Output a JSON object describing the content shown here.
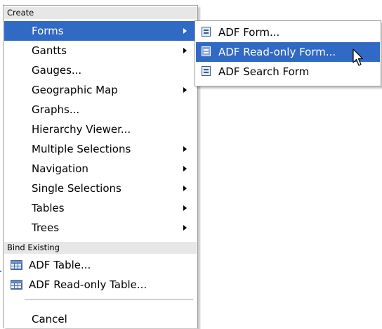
{
  "main_menu": {
    "create_header": "Create",
    "create_items": [
      {
        "label": "Forms",
        "has_submenu": true,
        "highlighted": true
      },
      {
        "label": "Gantts",
        "has_submenu": true
      },
      {
        "label": "Gauges...",
        "has_submenu": false
      },
      {
        "label": "Geographic Map",
        "has_submenu": true
      },
      {
        "label": "Graphs...",
        "has_submenu": false
      },
      {
        "label": "Hierarchy Viewer...",
        "has_submenu": false
      },
      {
        "label": "Multiple Selections",
        "has_submenu": true
      },
      {
        "label": "Navigation",
        "has_submenu": true
      },
      {
        "label": "Single Selections",
        "has_submenu": true
      },
      {
        "label": "Tables",
        "has_submenu": true
      },
      {
        "label": "Trees",
        "has_submenu": true
      }
    ],
    "bind_header": "Bind Existing",
    "bind_items": [
      {
        "label": "ADF Table...",
        "icon": "table-icon"
      },
      {
        "label": "ADF Read-only Table...",
        "icon": "table-icon"
      }
    ],
    "cancel_label": "Cancel"
  },
  "forms_submenu": {
    "items": [
      {
        "label": "ADF Form...",
        "icon": "form-icon"
      },
      {
        "label": "ADF Read-only Form...",
        "icon": "form-icon",
        "highlighted": true
      },
      {
        "label": "ADF Search Form",
        "icon": "form-icon"
      }
    ]
  },
  "colors": {
    "highlight": "#316ac5",
    "section_header_bg": "#e7e7e7",
    "menu_border": "#9a9a9a"
  }
}
